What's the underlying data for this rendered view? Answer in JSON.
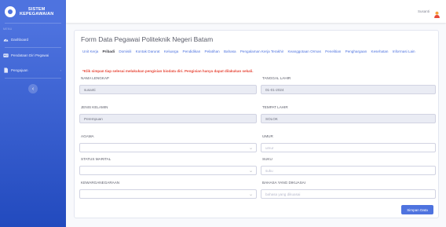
{
  "sidebar": {
    "brand_line1": "SISTEM",
    "brand_line2": "KEPEGAWAIAN",
    "heading": "MENU",
    "items": [
      {
        "label": "Dashboard",
        "icon": "tachometer-icon"
      },
      {
        "label": "Pendataan Diri Pegawai",
        "icon": "id-card-icon"
      },
      {
        "label": "Pengajuan",
        "icon": "file-icon"
      }
    ],
    "toggle_icon": "chevron-left-icon"
  },
  "topbar": {
    "user_name": "Susanti",
    "avatar_icon": "user-avatar-icon"
  },
  "form": {
    "title": "Form Data Pegawai Politeknik Negeri Batam",
    "tabs": [
      "Unit Kerja",
      "Pribadi",
      "Domisili",
      "Kontak Darurat",
      "Keluarga",
      "Pendidikan",
      "Pelatihan",
      "Bahasa",
      "Pengalaman Kerja Terakhir",
      "Keanggotaan Ormas",
      "Penelitian",
      "Penghargaan",
      "Kesehatan",
      "Informasi Lain"
    ],
    "active_tab": "Pribadi",
    "notice": "*Klik simpan tiap selesai melakukan pengisian biodata diri. Pengisian hanya dapat dilakukan sekali.",
    "nama_label": "NAMA LENGKAP",
    "nama_value": "susanti",
    "tgl_label": "TANGGAL LAHIR",
    "tgl_value": "01-01-2024",
    "jk_label": "JENIS KELAMIN",
    "jk_value": "Perempuan",
    "tempat_label": "TEMPAT LAHIR",
    "tempat_value": "SOLOK",
    "agama_label": "AGAMA",
    "agama_value": "",
    "umur_label": "UMUR",
    "umur_placeholder": "umur",
    "status_label": "STATUS MARITAL",
    "status_value": "",
    "suku_label": "SUKU",
    "suku_placeholder": "suku",
    "kwn_label": "KEWARGANEGARAAN",
    "kwn_value": "",
    "bahasa_label": "BAHASA YANG DIKUASAI",
    "bahasa_placeholder": "bahasa yang dikuasai",
    "submit_label": "Simpan Data"
  },
  "colors": {
    "primary": "#4e73df",
    "danger": "#e74a3b",
    "sidebar_bottom": "#224abe",
    "readonly_bg": "#eaecf4"
  }
}
